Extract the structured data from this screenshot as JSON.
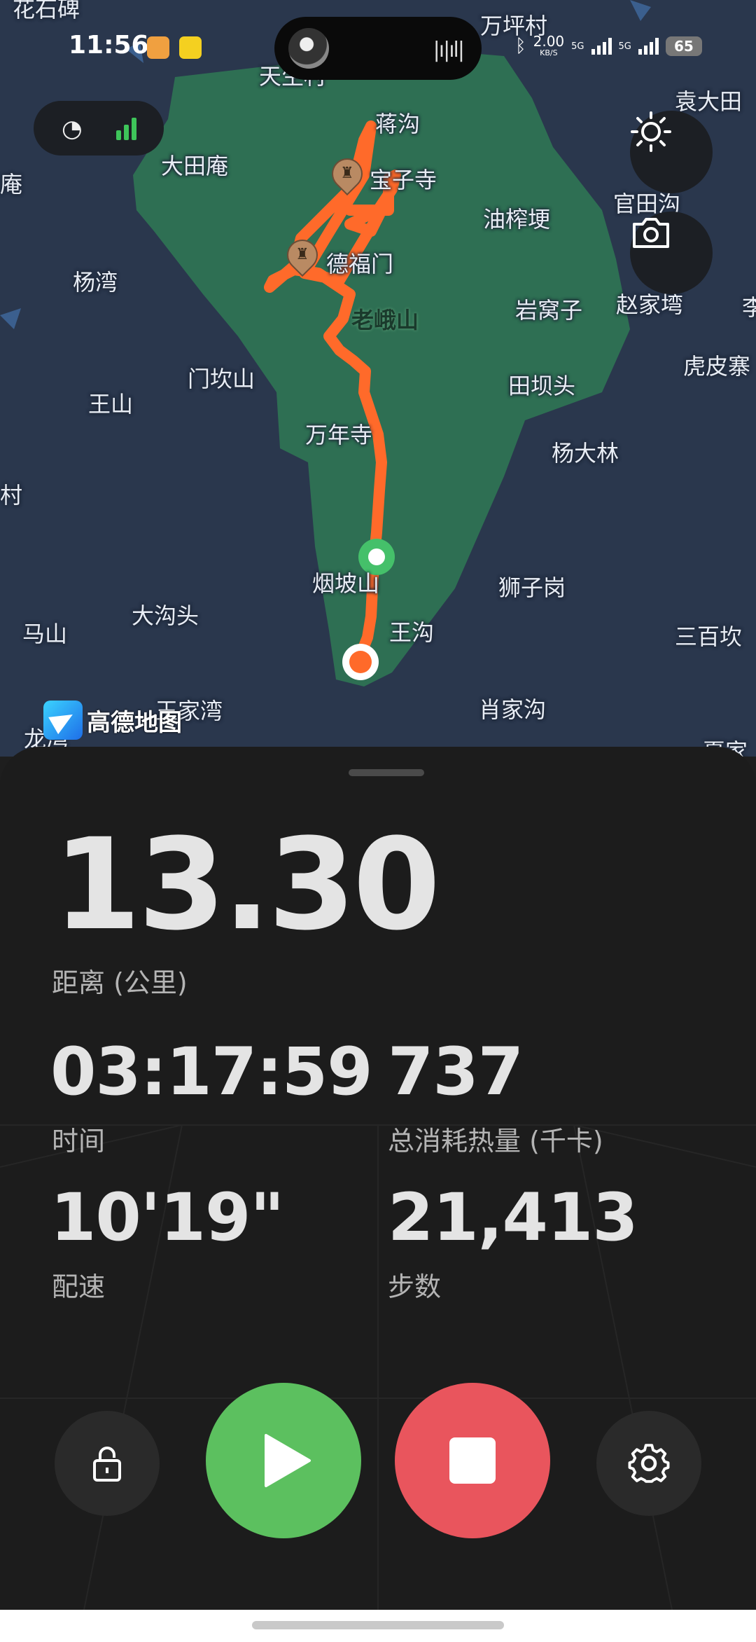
{
  "status_bar": {
    "time": "11:56",
    "speed_value": "2.00",
    "speed_unit": "KB/S",
    "sim1": "5G",
    "sim2": "5G",
    "battery": "65"
  },
  "map": {
    "provider_logo": "高德地图",
    "place_labels": [
      {
        "text": "花石碑"
      },
      {
        "text": "万坪村"
      },
      {
        "text": "天生村"
      },
      {
        "text": "蒋沟"
      },
      {
        "text": "袁大田"
      },
      {
        "text": "大田庵"
      },
      {
        "text": "庵"
      },
      {
        "text": "宝子寺"
      },
      {
        "text": "官田沟"
      },
      {
        "text": "油榨埂"
      },
      {
        "text": "德福门"
      },
      {
        "text": "杨湾"
      },
      {
        "text": "老峨山"
      },
      {
        "text": "岩窝子"
      },
      {
        "text": "赵家塆"
      },
      {
        "text": "李"
      },
      {
        "text": "虎皮寨"
      },
      {
        "text": "门坎山"
      },
      {
        "text": "田坝头"
      },
      {
        "text": "王山"
      },
      {
        "text": "万年寺"
      },
      {
        "text": "杨大林"
      },
      {
        "text": "村"
      },
      {
        "text": "烟坡山"
      },
      {
        "text": "狮子岗"
      },
      {
        "text": "大沟头"
      },
      {
        "text": "马山"
      },
      {
        "text": "王沟"
      },
      {
        "text": "三百坎"
      },
      {
        "text": "王家湾"
      },
      {
        "text": "肖家沟"
      },
      {
        "text": "龙湾"
      },
      {
        "text": "夏家"
      }
    ]
  },
  "stats": {
    "distance_value": "13.30",
    "distance_label": "距离 (公里)",
    "time_value": "03:17:59",
    "time_label": "时间",
    "calories_value": "737",
    "calories_label": "总消耗热量 (千卡)",
    "pace_value": "10'19\"",
    "pace_label": "配速",
    "steps_value": "21,413",
    "steps_label": "步数"
  },
  "icons": {
    "gps": "gps-satellite-icon",
    "brightness": "brightness-icon",
    "camera": "camera-icon",
    "lock": "lock-icon",
    "resume": "play-icon",
    "stop": "stop-icon",
    "settings": "gear-icon"
  },
  "colors": {
    "map_bg": "#2a374d",
    "park_green": "#2e6f53",
    "route": "#ff6a2a",
    "resume_green": "#5cc05f",
    "stop_red": "#e9555d",
    "panel_bg": "#1c1c1c"
  }
}
